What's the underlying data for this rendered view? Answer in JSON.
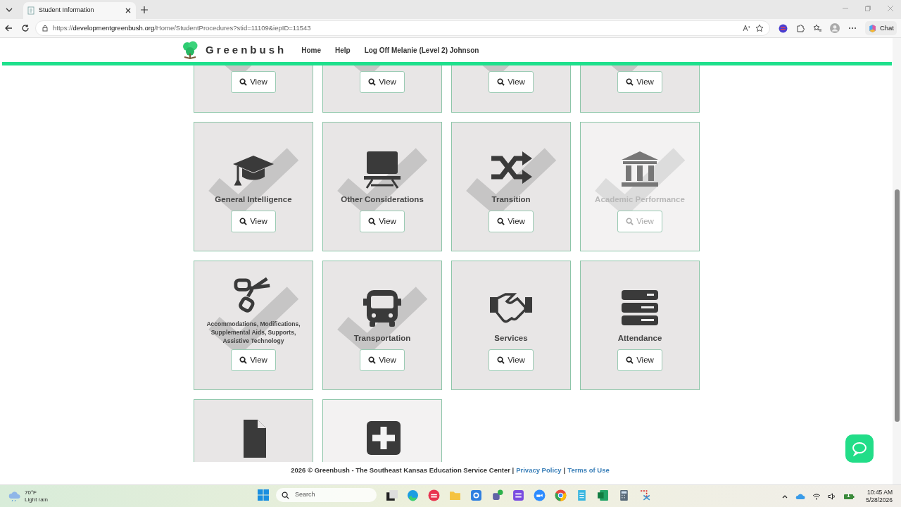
{
  "browser": {
    "tab_title": "Student Information",
    "url_host": "developmentgreenbush.org",
    "url_scheme": "https://",
    "url_path": "/Home/StudentProcedures?stid=11109&iepID=11543",
    "chat_label": "Chat"
  },
  "header": {
    "logo_text": "Greenbush",
    "nav": [
      "Home",
      "Help",
      "Log Off Melanie (Level 2) Johnson"
    ]
  },
  "cards": [
    {
      "completed": true,
      "disabled": false,
      "button": "View"
    },
    {
      "completed": true,
      "disabled": false,
      "button": "View"
    },
    {
      "completed": true,
      "disabled": false,
      "button": "View"
    },
    {
      "completed": true,
      "disabled": false,
      "button": "View"
    },
    {
      "label": "General Intelligence",
      "completed": true,
      "disabled": false,
      "button": "View"
    },
    {
      "label": "Other Considerations",
      "completed": true,
      "disabled": false,
      "button": "View"
    },
    {
      "label": "Transition",
      "completed": true,
      "disabled": false,
      "button": "View"
    },
    {
      "label": "Academic Performance",
      "completed": true,
      "disabled": true,
      "button": "View"
    },
    {
      "label": "Accommodations, Modifications, Supplemental Aids, Supports, Assistive Technology",
      "completed": true,
      "disabled": false,
      "button": "View"
    },
    {
      "label": "Transportation",
      "completed": true,
      "disabled": false,
      "button": "View"
    },
    {
      "label": "Services",
      "completed": false,
      "disabled": false,
      "button": "View"
    },
    {
      "label": "Attendance",
      "completed": false,
      "disabled": false,
      "button": "View"
    },
    {
      "completed": false,
      "disabled": false
    },
    {
      "completed": false,
      "disabled": true
    }
  ],
  "footer": {
    "text": "2026 © Greenbush - The Southeast Kansas Education Service Center |",
    "links": [
      "Privacy Policy",
      "Terms of Use"
    ],
    "separator": "|"
  },
  "taskbar": {
    "temperature": "70°F",
    "weather": "Light rain",
    "search_placeholder": "Search",
    "time": "10:45 AM",
    "date": "5/28/2026"
  }
}
